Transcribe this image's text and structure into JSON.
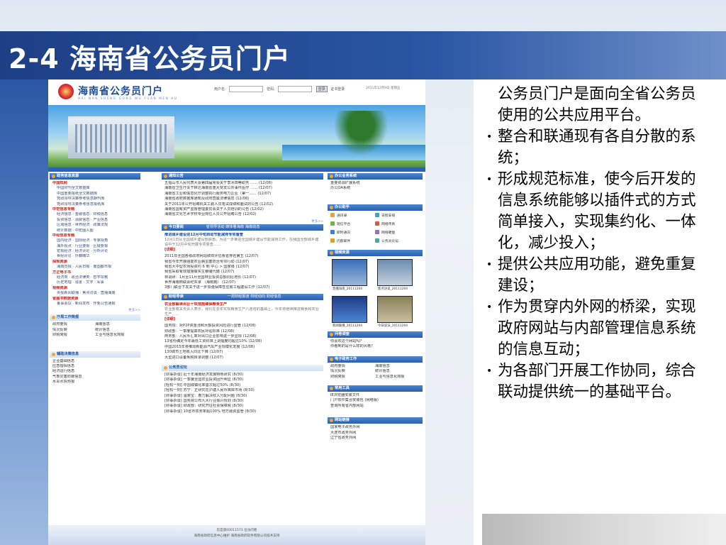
{
  "slide": {
    "title": "2-4 海南省公务员门户",
    "intro": "公务员门户是面向全省公务员使用的公共应用平台。",
    "bullets": [
      "整合和联通现有各自分散的系统；",
      "形成规范标准，使今后开发的信息系统能够以插件式的方式简单接入，实现集约化、一体化，减少投入；",
      "提供公共应用功能，避免重复建设；",
      "作为贯穿内外网的桥梁，实现政府网站与内部管理信息系统的信息互动；",
      "为各部门开展工作协同，综合联动提供统一的基础平台。"
    ],
    "bullet_glyph": "•"
  },
  "portal": {
    "logo_cn": "海南省公务员门户",
    "logo_en": "HAI NAN SHENG GONG WU YUAN MEN HU",
    "user_label": "用户名:",
    "password_label": "密码:",
    "login_button": "登录",
    "cert_login": "证书登录",
    "date": "2011年12月9日 星期五",
    "left": {
      "policy_header": "政务信息资源",
      "policy_items": [
        {
          "text": "中国知网",
          "kind": "red"
        },
        {
          "text": "中国财刊全文数据库",
          "kind": "ind"
        },
        {
          "text": "中国重要报纸全文数据库",
          "kind": "ind"
        },
        {
          "text": "党政领导决策参考信息期刊库",
          "kind": "ind"
        },
        {
          "text": "党政领导决策参考信息报纸库",
          "kind": "ind"
        },
        {
          "text": "中宏信息专题",
          "kind": "red"
        },
        {
          "text": "经济信息 · 金融信息 · 财税信息",
          "kind": "ind"
        },
        {
          "text": "投资信息 · 消费信息 · 产业信息",
          "kind": "ind"
        },
        {
          "text": "区域信息 · 世界经济 · 政策法规",
          "kind": "ind"
        },
        {
          "text": "统计数据 · 中宏图人图",
          "kind": "ind"
        },
        {
          "text": "中经信息专题",
          "kind": "red"
        },
        {
          "text": "国内经济 · 国际经济 · 专家视角",
          "kind": "ind"
        },
        {
          "text": "海外视点 · 行业要报 · 区域要报",
          "kind": "ind"
        },
        {
          "text": "宏观经济 · 经济评论 · 分析评论",
          "kind": "ind"
        },
        {
          "text": "世经评论 · 外籍瞰华",
          "kind": "ind"
        },
        {
          "text": "探规资源",
          "kind": "red"
        },
        {
          "text": "海南日报 · 人民日报 · 南国都市报",
          "kind": "ind"
        },
        {
          "text": "方正电子书",
          "kind": "red"
        },
        {
          "text": "经济类 · 政治法律类 · 哲学宗教",
          "kind": "ind"
        },
        {
          "text": "历史地理 · 语言 · 文字 · 军事",
          "kind": "ind"
        },
        {
          "text": "视频资源",
          "kind": "red"
        },
        {
          "text": "央视新闻联播 · 焦点访谈 · 直播海南",
          "kind": "ind"
        },
        {
          "text": "省图书数据资源",
          "kind": "red"
        },
        {
          "text": "董事会议 · 新闻发布 · 作免公告通报",
          "kind": "ind"
        }
      ],
      "more": "更多>>",
      "work_header": "厅局工作简报",
      "work_items": [
        "政府要情",
        "海南信息",
        "情况反映",
        "统计信息",
        "财税简报",
        "工业与信息化简报"
      ],
      "decision_header": "辅助决策信息",
      "decision_items": [
        "企业基础信息",
        "应急指挥信息",
        "经济运行信息",
        "气象灾害防御信息",
        "水旱水情预报"
      ]
    },
    "center": {
      "notice_header": "通知公告",
      "notices": [
        "五指山市人民代表大会第四届常会关于李冰田等职务 …… (12/08)",
        "海南省卫生厅关于转达海南省重大突发公共事件医疗 …… (12/07)",
        "海南省工业和信息化厅调整执行服务电力企业（第一…… (12/07)",
        "海南省政府数据库通知及政府直属法律信息 (12/08)",
        "关于2011年公开招聘机关工勤人员笔试成绩和面试的公告 (12/02)",
        "海南省国有资产监督管理委员会关于人员培训的公告 (12/02)",
        "海南省文化艺术学校专业岗位人员公开招聘公告 (12/02)"
      ],
      "today_header": "今日要闻",
      "today_tabs": "省领导活动 媒体看海南 海南动态",
      "headline": "推进城乡建设进12月中旬启动节能减排专项督查",
      "headline_summary": "12月1日从全国城乡建设部获悉，为进一步推进全国城乡建设节能减排工作，在我国全部城乡建设中于12月中旬开展专项督查……",
      "detail_label": "[详细]",
      "today_items": [
        "2011年全国各级政府网站绩效评估我省排名第五 (12/07)",
        "我省今年开展强能农业病虫害防治专项行动 (12/07)",
        "我省大中型农场投资约 6 到 中心 > 国家级 (12/07)",
        "我省采取有效措施做实主粮储代储 (12/07)",
        "林调研：1月至11月全国林业投资总额同比增长 (12/07)",
        "世界海南商联会纪实录 （海南篇） (12/07)",
        "3部门联合下发关于进一步加强保障性住房工程建设工作 (12/07)"
      ],
      "finance_header": "财经导读",
      "finance_tabs": "一周财经报道 财经动向 财经信息",
      "finance_headline": "农业部解读出台十项措施确保粮食生产",
      "finance_summary": "农业部有关负责人表示，我们在去年实现粮食生产八连增的基础上，今年将继续推进粮食和农业生产……",
      "finance_detail": "[详细]",
      "finance_items": [
        "国务院：对P2P资金池和大额投资风险进行监管 (12/08)",
        "财政部：一季度提高农民补贴标准 (12/08)",
        "商务部：人民币汇率对出口企业影响进一步显现 (12/08)",
        "13省份确定今年最低工资标准上调幅度均超过10% (12/08)",
        "中国2015年将推动新能源汽车产业规模化发展 (12/08)",
        "130城市土地收入同比下降 (12/07)",
        "大型进口设备免税目录调整 (12/07)"
      ],
      "forum_header": "公务员论坛",
      "forum_items": [
        "[财事杂谈] 近十年海南经济发展特色研究 (8/30)",
        "[财事杂谈] 一季度全国农业投资回升明显 (8/30)",
        "[轻松一刻] 中国城镇化率首次超过50% (8/30)",
        "[轻松一刻] 苏宁：正研究在沪建人民币离岸市场 (8/30)",
        "[财事杂谈] 温家宝：着力解决收入分配问题 (8/30)",
        "[财事杂谈] 国务院公布九大行业振兴规划 (8/30)",
        "[财事杂谈] 财政部：研究开征社会保障税 (8/30)",
        "[财事杂谈] 10省市债务率超100% 地方融资监管 (8/30)"
      ]
    },
    "right": {
      "office_header": "办公业务系统",
      "office_items": [
        "重要资源扩展系统",
        "办公OA系统"
      ],
      "helper_header": "办公助手",
      "helpers": [
        "通讯录",
        "日程安排",
        "短信平台",
        "网络传真",
        "即时通讯",
        "网络硬盘",
        "内部邮件",
        "公务员论坛"
      ],
      "video_header": "视频资源",
      "videos": [
        "直播海南_20111204",
        "焦点访谈_20111204",
        "新闻联播_20111204",
        "今日说法_20111204"
      ],
      "survey_header": "问卷调查",
      "surveys": [
        "你喜欢这个网站吗？",
        "你看到的是什么样的风格？"
      ],
      "egov_header": "电子政务工作",
      "egov_items": [
        "政府要情",
        "海南信息",
        "情况反映",
        "统计信息",
        "财税简报",
        "工业与信息化简报"
      ],
      "tools_header": "常用工具",
      "tools": [
        "IE浏览器安装文件",
        "门户软件集合安装包 (网络版)",
        "查询所有省内部网站"
      ],
      "links_header": "网站链接",
      "links": [
        "国家电子政务外网",
        "大连市政务外网",
        "辽宁省政务外网"
      ]
    },
    "footer_line1": "您是第00011573 位访问者",
    "footer_line2": "海南省政府信息中心维护    海南省政府软件有限公司技术支持"
  }
}
